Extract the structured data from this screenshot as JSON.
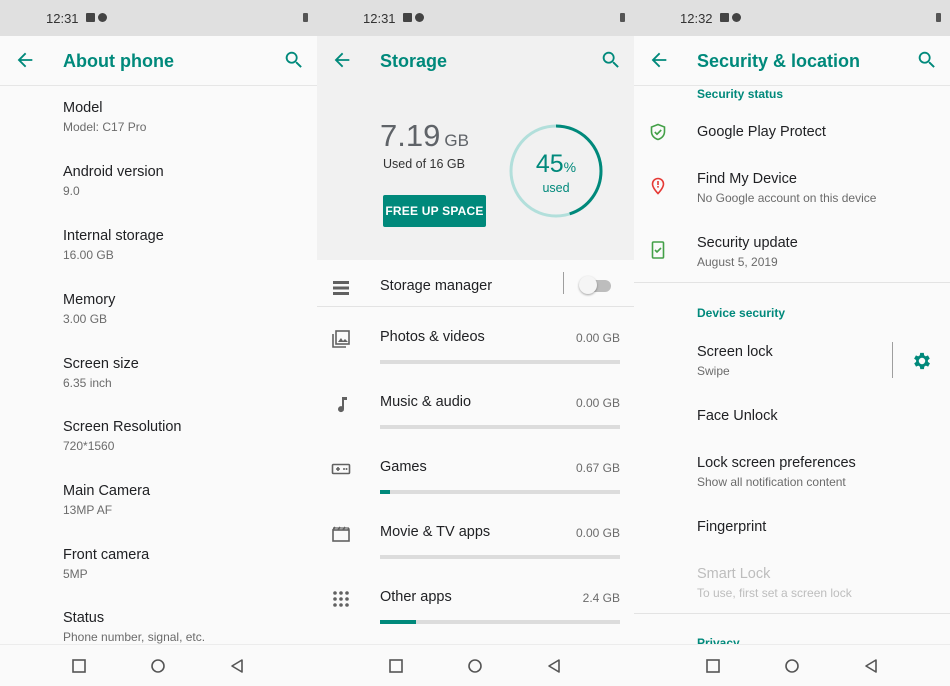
{
  "screens": {
    "about": {
      "time": "12:31",
      "title": "About phone",
      "items": [
        {
          "label": "Model",
          "value": "Model: C17 Pro"
        },
        {
          "label": "Android version",
          "value": "9.0"
        },
        {
          "label": "Internal storage",
          "value": "16.00 GB"
        },
        {
          "label": "Memory",
          "value": "3.00 GB"
        },
        {
          "label": "Screen size",
          "value": "6.35 inch"
        },
        {
          "label": "Screen Resolution",
          "value": "720*1560"
        },
        {
          "label": "Main Camera",
          "value": "13MP AF"
        },
        {
          "label": "Front camera",
          "value": "5MP"
        },
        {
          "label": "Status",
          "value": "Phone number, signal, etc."
        }
      ]
    },
    "storage": {
      "time": "12:31",
      "title": "Storage",
      "used_amount": "7.19",
      "used_unit": "GB",
      "used_of": "Used of 16 GB",
      "free_button": "FREE UP SPACE",
      "percent": "45",
      "percent_sign": "%",
      "percent_label": "used",
      "percent_value": 45,
      "manager_label": "Storage manager",
      "manager_enabled": false,
      "categories": [
        {
          "label": "Photos & videos",
          "size": "0.00 GB",
          "fraction": 0.0,
          "icon": "photos-icon"
        },
        {
          "label": "Music & audio",
          "size": "0.00 GB",
          "fraction": 0.0,
          "icon": "music-note-icon"
        },
        {
          "label": "Games",
          "size": "0.67 GB",
          "fraction": 0.04,
          "icon": "gamepad-icon"
        },
        {
          "label": "Movie & TV apps",
          "size": "0.00 GB",
          "fraction": 0.0,
          "icon": "movie-icon"
        },
        {
          "label": "Other apps",
          "size": "2.4 GB",
          "fraction": 0.15,
          "icon": "apps-grid-icon"
        }
      ]
    },
    "security": {
      "time": "12:32",
      "title": "Security & location",
      "status_header": "Security status",
      "play_protect": "Google Play Protect",
      "find_device": "Find My Device",
      "find_device_sub": "No Google account on this device",
      "update": "Security update",
      "update_sub": "August 5, 2019",
      "device_header": "Device security",
      "screen_lock": "Screen lock",
      "screen_lock_sub": "Swipe",
      "face_unlock": "Face Unlock",
      "lock_prefs": "Lock screen preferences",
      "lock_prefs_sub": "Show all notification content",
      "fingerprint": "Fingerprint",
      "smart_lock": "Smart Lock",
      "smart_lock_sub": "To use, first set a screen lock",
      "privacy_header": "Privacy"
    }
  },
  "colors": {
    "accent": "#00897b",
    "shield": "#43a047",
    "location_pin": "#e53935"
  }
}
